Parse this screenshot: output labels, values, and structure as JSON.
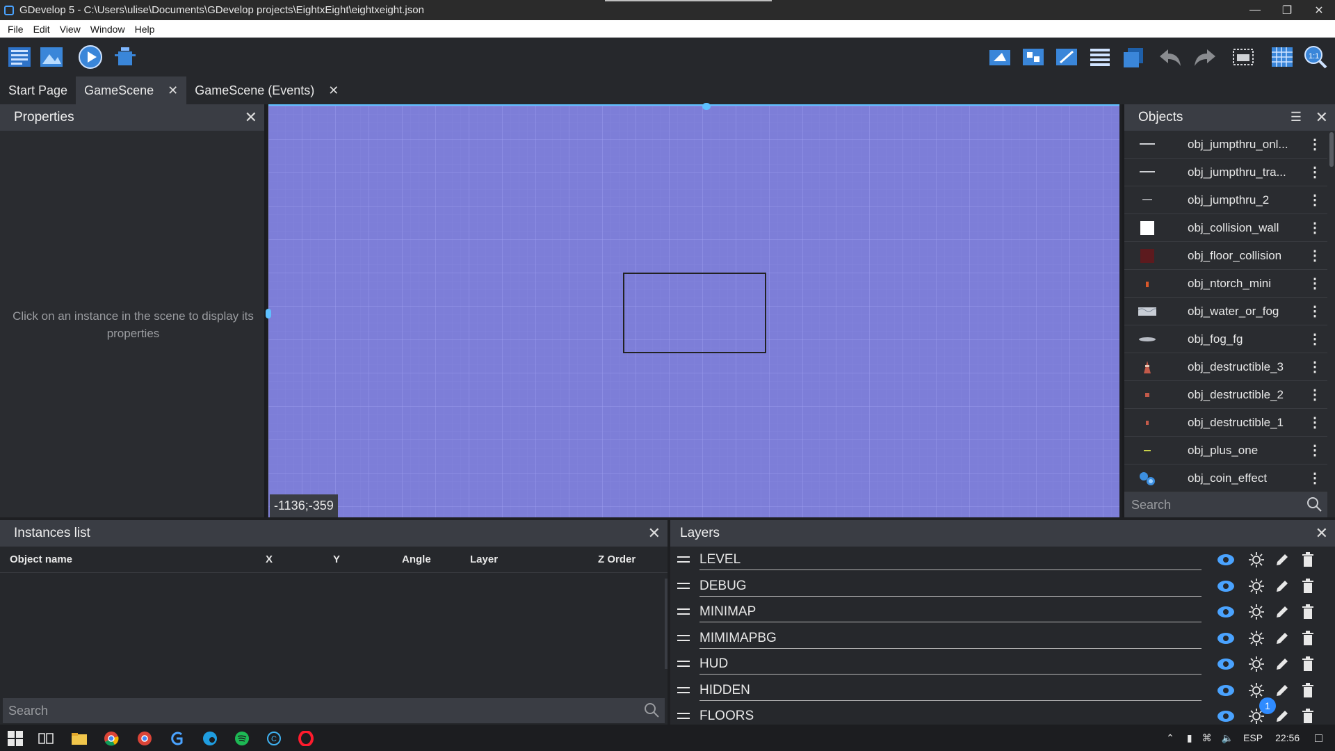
{
  "window": {
    "title": "GDevelop 5 - C:\\Users\\ulise\\Documents\\GDevelop projects\\EightxEight\\eightxeight.json"
  },
  "menu": [
    "File",
    "Edit",
    "View",
    "Window",
    "Help"
  ],
  "tabs": [
    {
      "label": "Start Page"
    },
    {
      "label": "GameScene"
    },
    {
      "label": "GameScene (Events)"
    }
  ],
  "properties": {
    "title": "Properties",
    "hint": "Click on an instance in the scene to display its properties"
  },
  "scene": {
    "coords": "-1136;-359",
    "background_color": "#7d7ed8"
  },
  "objects": {
    "title": "Objects",
    "search_placeholder": "Search",
    "items": [
      {
        "name": "obj_jumpthru_onl...",
        "icon": "line-icon"
      },
      {
        "name": "obj_jumpthru_tra...",
        "icon": "line-icon"
      },
      {
        "name": "obj_jumpthru_2",
        "icon": "line-icon"
      },
      {
        "name": "obj_collision_wall",
        "icon": "white-square-icon"
      },
      {
        "name": "obj_floor_collision",
        "icon": "dark-red-square-icon"
      },
      {
        "name": "obj_ntorch_mini",
        "icon": "torch-icon"
      },
      {
        "name": "obj_water_or_fog",
        "icon": "water-icon"
      },
      {
        "name": "obj_fog_fg",
        "icon": "fog-icon"
      },
      {
        "name": "obj_destructible_3",
        "icon": "vase-icon"
      },
      {
        "name": "obj_destructible_2",
        "icon": "vase-icon"
      },
      {
        "name": "obj_destructible_1",
        "icon": "vase-icon"
      },
      {
        "name": "obj_plus_one",
        "icon": "plus-one-icon"
      },
      {
        "name": "obj_coin_effect",
        "icon": "coin-icon"
      }
    ]
  },
  "instances": {
    "title": "Instances list",
    "columns": [
      "Object name",
      "X",
      "Y",
      "Angle",
      "Layer",
      "Z Order"
    ],
    "search_placeholder": "Search"
  },
  "layers": {
    "title": "Layers",
    "items": [
      "LEVEL",
      "DEBUG",
      "MINIMAP",
      "MIMIMAPBG",
      "HUD",
      "HIDDEN",
      "FLOORS"
    ],
    "badge": "1"
  },
  "taskbar": {
    "language": "ESP",
    "time": "22:56"
  }
}
